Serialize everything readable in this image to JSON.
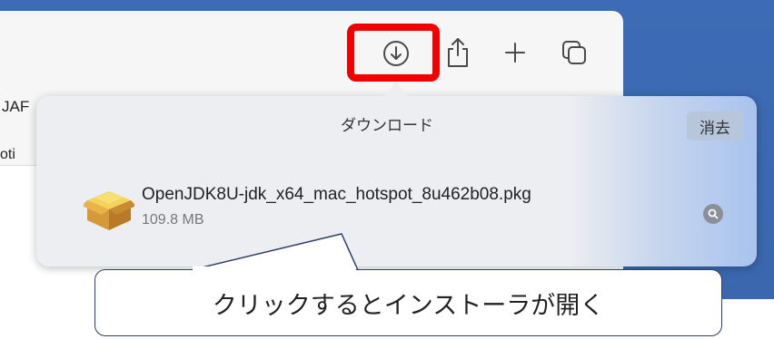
{
  "sidebar": {
    "partial_text_1": "JAF",
    "partial_text_2": "oti"
  },
  "toolbar": {
    "buttons": [
      {
        "name": "download-icon"
      },
      {
        "name": "share-icon"
      },
      {
        "name": "new-tab-icon"
      },
      {
        "name": "tab-overview-icon"
      }
    ]
  },
  "downloads_popover": {
    "title": "ダウンロード",
    "clear_label": "消去",
    "items": [
      {
        "file_name": "OpenJDK8U-jdk_x64_mac_hotspot_8u462b08.pkg",
        "size": "109.8 MB",
        "icon": "package-icon"
      }
    ]
  },
  "annotation": {
    "callout_text": "クリックするとインストーラが開く",
    "highlight_color": "#f20000"
  }
}
